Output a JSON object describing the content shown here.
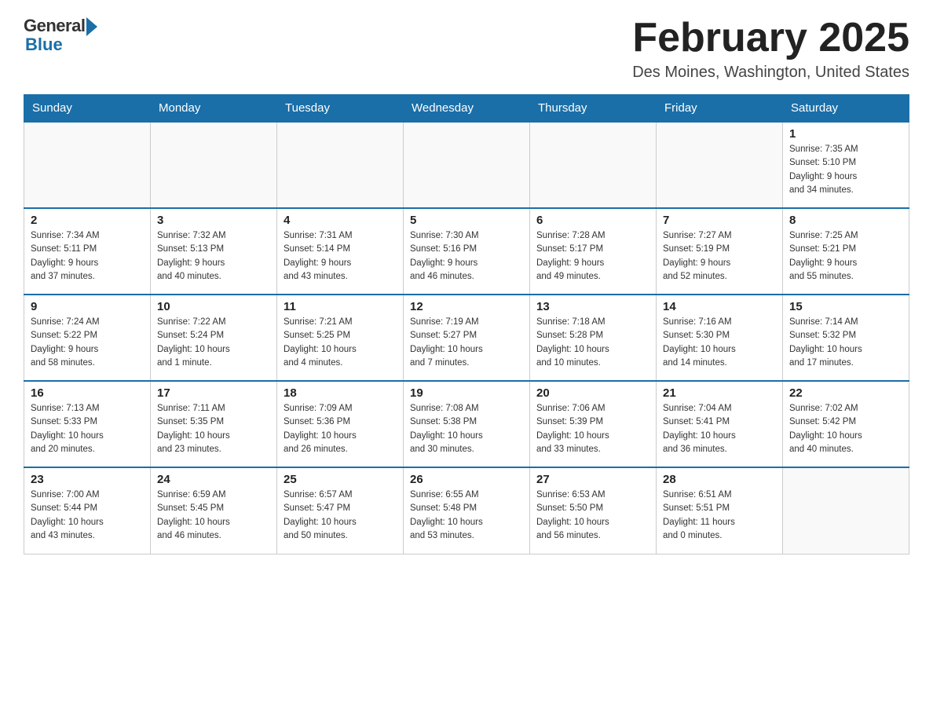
{
  "header": {
    "logo_general": "General",
    "logo_blue": "Blue",
    "title": "February 2025",
    "subtitle": "Des Moines, Washington, United States"
  },
  "days_of_week": [
    "Sunday",
    "Monday",
    "Tuesday",
    "Wednesday",
    "Thursday",
    "Friday",
    "Saturday"
  ],
  "weeks": [
    [
      {
        "day": "",
        "info": ""
      },
      {
        "day": "",
        "info": ""
      },
      {
        "day": "",
        "info": ""
      },
      {
        "day": "",
        "info": ""
      },
      {
        "day": "",
        "info": ""
      },
      {
        "day": "",
        "info": ""
      },
      {
        "day": "1",
        "info": "Sunrise: 7:35 AM\nSunset: 5:10 PM\nDaylight: 9 hours\nand 34 minutes."
      }
    ],
    [
      {
        "day": "2",
        "info": "Sunrise: 7:34 AM\nSunset: 5:11 PM\nDaylight: 9 hours\nand 37 minutes."
      },
      {
        "day": "3",
        "info": "Sunrise: 7:32 AM\nSunset: 5:13 PM\nDaylight: 9 hours\nand 40 minutes."
      },
      {
        "day": "4",
        "info": "Sunrise: 7:31 AM\nSunset: 5:14 PM\nDaylight: 9 hours\nand 43 minutes."
      },
      {
        "day": "5",
        "info": "Sunrise: 7:30 AM\nSunset: 5:16 PM\nDaylight: 9 hours\nand 46 minutes."
      },
      {
        "day": "6",
        "info": "Sunrise: 7:28 AM\nSunset: 5:17 PM\nDaylight: 9 hours\nand 49 minutes."
      },
      {
        "day": "7",
        "info": "Sunrise: 7:27 AM\nSunset: 5:19 PM\nDaylight: 9 hours\nand 52 minutes."
      },
      {
        "day": "8",
        "info": "Sunrise: 7:25 AM\nSunset: 5:21 PM\nDaylight: 9 hours\nand 55 minutes."
      }
    ],
    [
      {
        "day": "9",
        "info": "Sunrise: 7:24 AM\nSunset: 5:22 PM\nDaylight: 9 hours\nand 58 minutes."
      },
      {
        "day": "10",
        "info": "Sunrise: 7:22 AM\nSunset: 5:24 PM\nDaylight: 10 hours\nand 1 minute."
      },
      {
        "day": "11",
        "info": "Sunrise: 7:21 AM\nSunset: 5:25 PM\nDaylight: 10 hours\nand 4 minutes."
      },
      {
        "day": "12",
        "info": "Sunrise: 7:19 AM\nSunset: 5:27 PM\nDaylight: 10 hours\nand 7 minutes."
      },
      {
        "day": "13",
        "info": "Sunrise: 7:18 AM\nSunset: 5:28 PM\nDaylight: 10 hours\nand 10 minutes."
      },
      {
        "day": "14",
        "info": "Sunrise: 7:16 AM\nSunset: 5:30 PM\nDaylight: 10 hours\nand 14 minutes."
      },
      {
        "day": "15",
        "info": "Sunrise: 7:14 AM\nSunset: 5:32 PM\nDaylight: 10 hours\nand 17 minutes."
      }
    ],
    [
      {
        "day": "16",
        "info": "Sunrise: 7:13 AM\nSunset: 5:33 PM\nDaylight: 10 hours\nand 20 minutes."
      },
      {
        "day": "17",
        "info": "Sunrise: 7:11 AM\nSunset: 5:35 PM\nDaylight: 10 hours\nand 23 minutes."
      },
      {
        "day": "18",
        "info": "Sunrise: 7:09 AM\nSunset: 5:36 PM\nDaylight: 10 hours\nand 26 minutes."
      },
      {
        "day": "19",
        "info": "Sunrise: 7:08 AM\nSunset: 5:38 PM\nDaylight: 10 hours\nand 30 minutes."
      },
      {
        "day": "20",
        "info": "Sunrise: 7:06 AM\nSunset: 5:39 PM\nDaylight: 10 hours\nand 33 minutes."
      },
      {
        "day": "21",
        "info": "Sunrise: 7:04 AM\nSunset: 5:41 PM\nDaylight: 10 hours\nand 36 minutes."
      },
      {
        "day": "22",
        "info": "Sunrise: 7:02 AM\nSunset: 5:42 PM\nDaylight: 10 hours\nand 40 minutes."
      }
    ],
    [
      {
        "day": "23",
        "info": "Sunrise: 7:00 AM\nSunset: 5:44 PM\nDaylight: 10 hours\nand 43 minutes."
      },
      {
        "day": "24",
        "info": "Sunrise: 6:59 AM\nSunset: 5:45 PM\nDaylight: 10 hours\nand 46 minutes."
      },
      {
        "day": "25",
        "info": "Sunrise: 6:57 AM\nSunset: 5:47 PM\nDaylight: 10 hours\nand 50 minutes."
      },
      {
        "day": "26",
        "info": "Sunrise: 6:55 AM\nSunset: 5:48 PM\nDaylight: 10 hours\nand 53 minutes."
      },
      {
        "day": "27",
        "info": "Sunrise: 6:53 AM\nSunset: 5:50 PM\nDaylight: 10 hours\nand 56 minutes."
      },
      {
        "day": "28",
        "info": "Sunrise: 6:51 AM\nSunset: 5:51 PM\nDaylight: 11 hours\nand 0 minutes."
      },
      {
        "day": "",
        "info": ""
      }
    ]
  ]
}
